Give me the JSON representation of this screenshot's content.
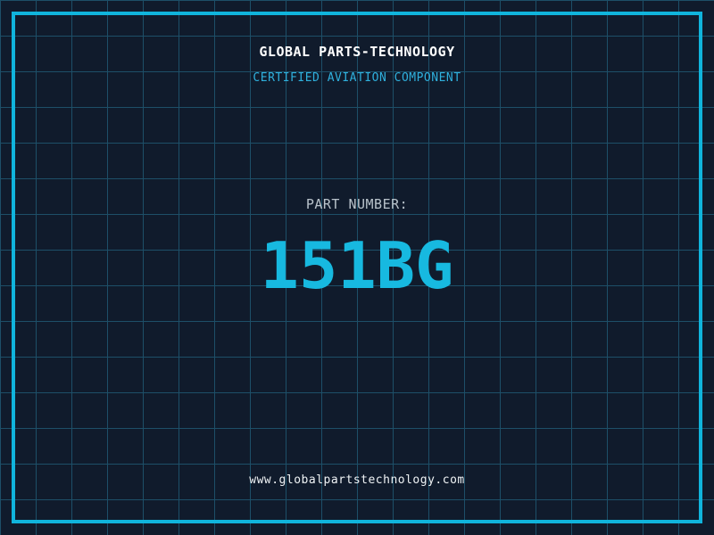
{
  "header": {
    "title": "GLOBAL PARTS-TECHNOLOGY",
    "subtitle": "CERTIFIED AVIATION COMPONENT"
  },
  "part": {
    "label": "PART NUMBER:",
    "number": "151BG"
  },
  "footer": {
    "website": "www.globalpartstechnology.com"
  },
  "colors": {
    "background": "#101b2c",
    "grid_line": "#1d4f68",
    "frame_border": "#10b4dc",
    "title_text": "#ffffff",
    "subtitle_text": "#2fb0dd",
    "part_label_text": "#b9c3cb",
    "part_number_text": "#17b9e0",
    "website_text": "#eff3f5"
  }
}
